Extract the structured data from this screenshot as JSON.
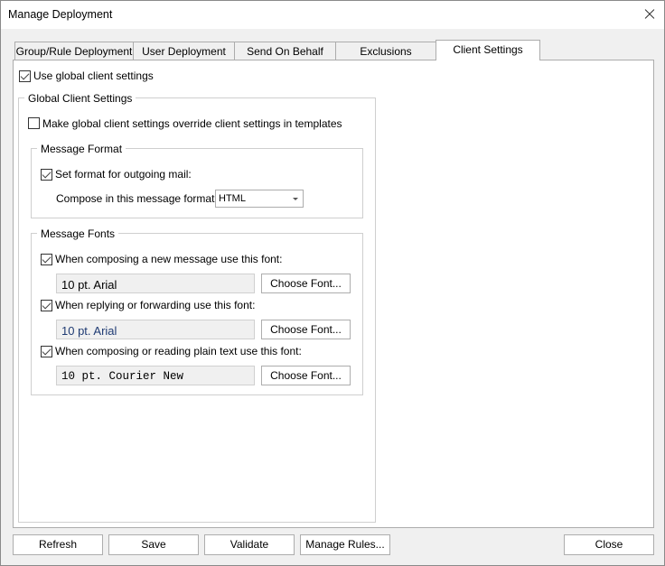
{
  "window": {
    "title": "Manage Deployment"
  },
  "tabs": [
    {
      "label": "Group/Rule Deployment"
    },
    {
      "label": "User Deployment"
    },
    {
      "label": "Send On Behalf"
    },
    {
      "label": "Exclusions"
    },
    {
      "label": "Client Settings",
      "active": true
    }
  ],
  "client_settings": {
    "use_global": {
      "label": "Use global client settings",
      "checked": true
    },
    "global_group_title": "Global Client Settings",
    "override": {
      "label": "Make global client settings override client settings in templates",
      "checked": false
    },
    "message_format": {
      "title": "Message Format",
      "set_format": {
        "label": "Set format for outgoing mail:",
        "checked": true
      },
      "compose_label": "Compose in this message format:",
      "format_value": "HTML"
    },
    "message_fonts": {
      "title": "Message Fonts",
      "new_message": {
        "label": "When composing a new message use this font:",
        "checked": true,
        "font": "10 pt. Arial",
        "button": "Choose Font..."
      },
      "reply_forward": {
        "label": "When replying or forwarding use this font:",
        "checked": true,
        "font": "10 pt. Arial",
        "button": "Choose Font..."
      },
      "plain_text": {
        "label": "When composing or reading plain text use this font:",
        "checked": true,
        "font": "10 pt. Courier New",
        "button": "Choose Font..."
      }
    }
  },
  "footer": {
    "refresh": "Refresh",
    "save": "Save",
    "validate": "Validate",
    "manage_rules": "Manage Rules...",
    "close": "Close"
  }
}
